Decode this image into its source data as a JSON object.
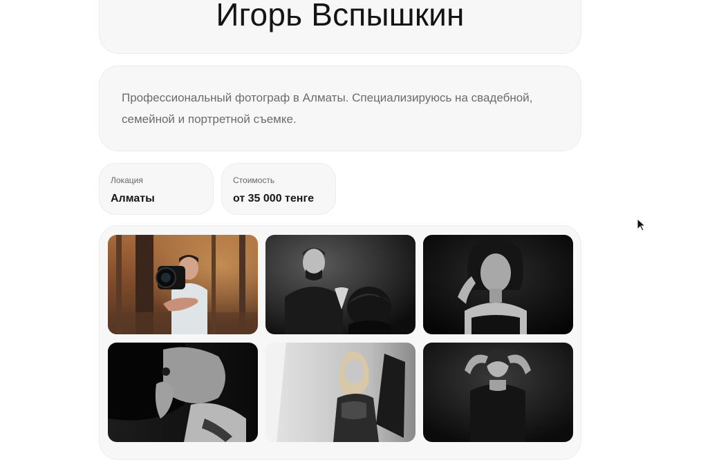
{
  "profile": {
    "name": "Игорь Вспышкин",
    "description": "Профессиональный фотограф в Алматы. Специализируюсь на свадебной, семейной и портретной съемке."
  },
  "info": {
    "location_label": "Локация",
    "location_value": "Алматы",
    "price_label": "Стоимость",
    "price_value": "от 35 000 тенге"
  },
  "gallery": {
    "photos": [
      {
        "subject": "photographer with camera in autumn forest"
      },
      {
        "subject": "barber cutting hair, black and white"
      },
      {
        "subject": "woman portrait, black and white"
      },
      {
        "subject": "woman with curly hair, black and white"
      },
      {
        "subject": "blonde model in studio with softbox"
      },
      {
        "subject": "woman with hands behind head, black and white"
      }
    ]
  }
}
